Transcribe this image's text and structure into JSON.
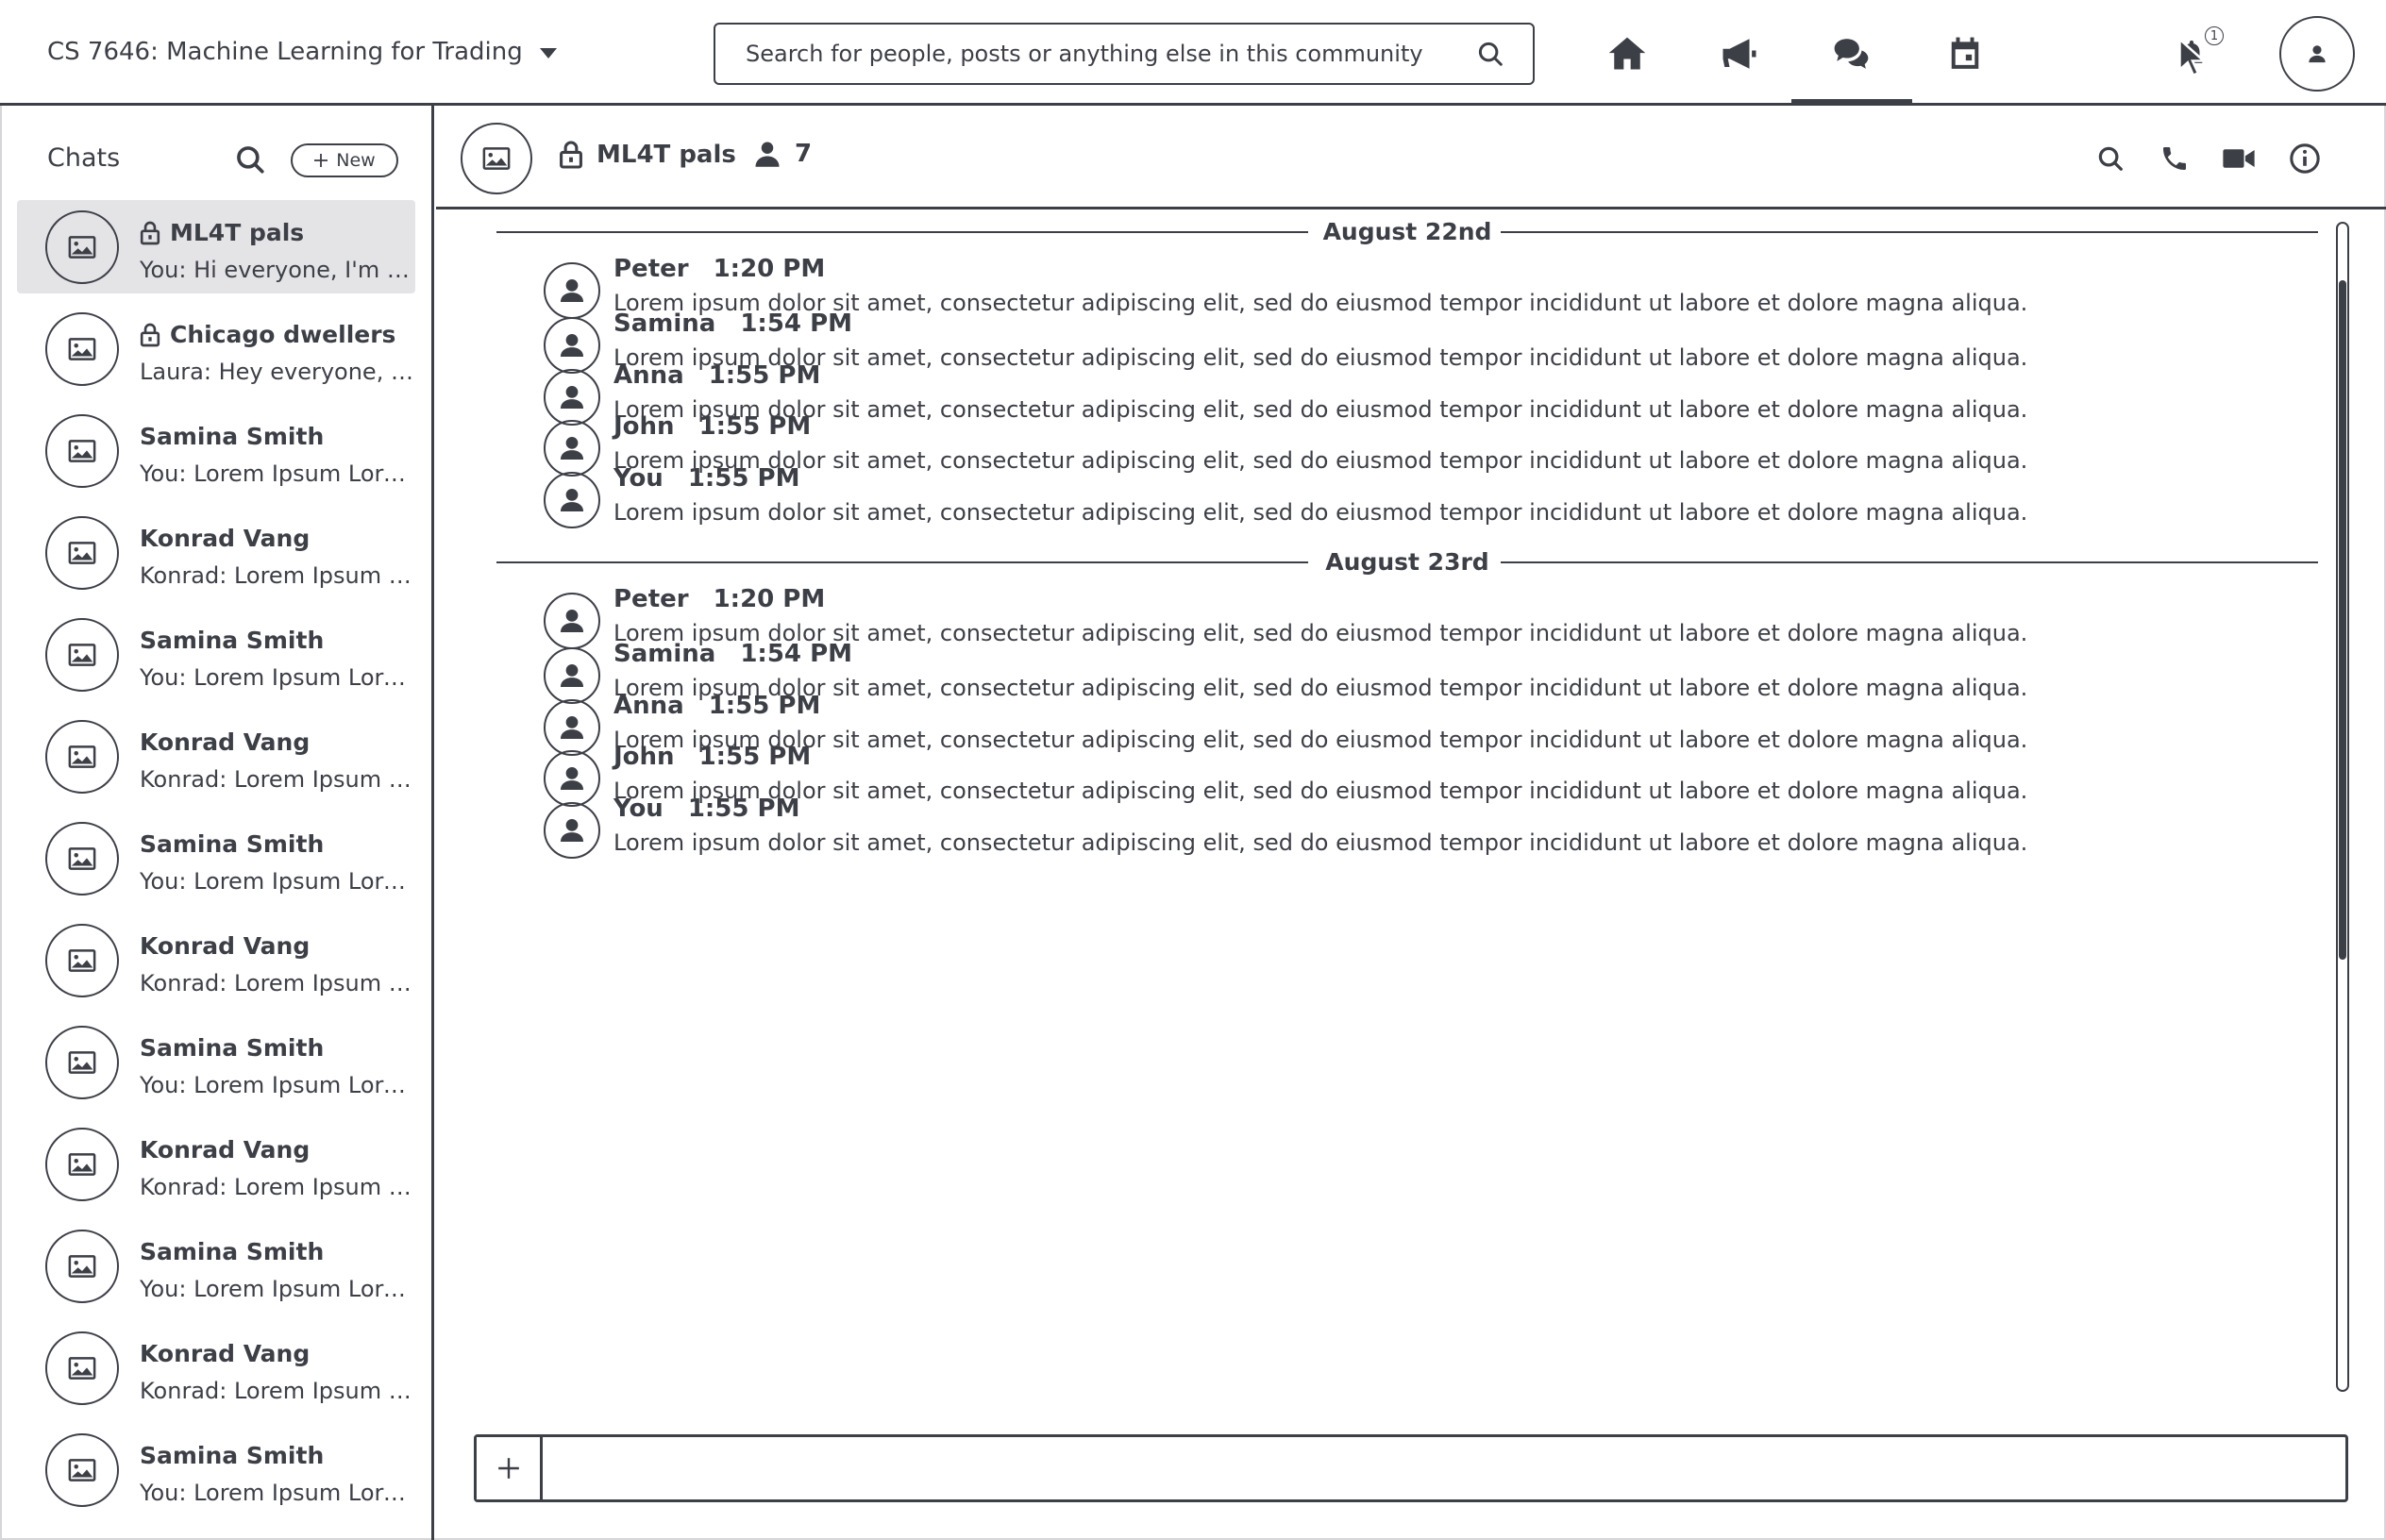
{
  "topbar": {
    "course": "CS 7646: Machine Learning for Trading",
    "search_placeholder": "Search for people, posts or anything else in this community",
    "icons": [
      "home-icon",
      "megaphone-icon",
      "chat-icon",
      "calendar-icon",
      "bell-icon",
      "profile-icon"
    ],
    "active_nav": "chat-icon",
    "notification_count": "1"
  },
  "sidebar": {
    "title": "Chats",
    "new_label": "New",
    "chats": [
      {
        "name": "ML4T pals",
        "preview": "You: Hi everyone, I'm Mike",
        "locked": true,
        "active": true
      },
      {
        "name": "Chicago dwellers",
        "preview": "Laura: Hey everyone, great",
        "locked": true,
        "active": false
      },
      {
        "name": "Samina Smith",
        "preview": "You: Lorem Ipsum Lorem",
        "locked": false,
        "active": false
      },
      {
        "name": "Konrad Vang",
        "preview": "Konrad: Lorem Ipsum Lorem",
        "locked": false,
        "active": false
      },
      {
        "name": "Samina Smith",
        "preview": "You: Lorem Ipsum Lorem",
        "locked": false,
        "active": false
      },
      {
        "name": "Konrad Vang",
        "preview": "Konrad: Lorem Ipsum Lorem",
        "locked": false,
        "active": false
      },
      {
        "name": "Samina Smith",
        "preview": "You: Lorem Ipsum Lorem",
        "locked": false,
        "active": false
      },
      {
        "name": "Konrad Vang",
        "preview": "Konrad: Lorem Ipsum Lorem",
        "locked": false,
        "active": false
      },
      {
        "name": "Samina Smith",
        "preview": "You: Lorem Ipsum Lorem",
        "locked": false,
        "active": false
      },
      {
        "name": "Konrad Vang",
        "preview": "Konrad: Lorem Ipsum Lorem",
        "locked": false,
        "active": false
      },
      {
        "name": "Samina Smith",
        "preview": "You: Lorem Ipsum Lorem",
        "locked": false,
        "active": false
      },
      {
        "name": "Konrad Vang",
        "preview": "Konrad: Lorem Ipsum Lorem",
        "locked": false,
        "active": false
      },
      {
        "name": "Samina Smith",
        "preview": "You: Lorem Ipsum Lorem",
        "locked": false,
        "active": false
      }
    ]
  },
  "conversation": {
    "title": "ML4T pals",
    "member_count": "7",
    "tools": [
      "search-icon",
      "phone-icon",
      "video-icon",
      "info-icon"
    ]
  },
  "messages": {
    "groups": [
      {
        "date": "August 22nd",
        "items": [
          {
            "author": "Peter",
            "time": "1:20 PM",
            "text": "Lorem ipsum dolor sit amet, consectetur adipiscing elit, sed do eiusmod tempor incididunt ut labore et dolore magna aliqua."
          },
          {
            "author": "Samina",
            "time": "1:54 PM",
            "text": "Lorem ipsum dolor sit amet, consectetur adipiscing elit, sed do eiusmod tempor incididunt ut labore et dolore magna aliqua."
          },
          {
            "author": "Anna",
            "time": "1:55 PM",
            "text": "Lorem ipsum dolor sit amet, consectetur adipiscing elit, sed do eiusmod tempor incididunt ut labore et dolore magna aliqua."
          },
          {
            "author": "John",
            "time": "1:55 PM",
            "text": "Lorem ipsum dolor sit amet, consectetur adipiscing elit, sed do eiusmod tempor incididunt ut labore et dolore magna aliqua."
          },
          {
            "author": "You",
            "time": "1:55 PM",
            "text": "Lorem ipsum dolor sit amet, consectetur adipiscing elit, sed do eiusmod tempor incididunt ut labore et dolore magna aliqua."
          }
        ]
      },
      {
        "date": "August 23rd",
        "items": [
          {
            "author": "Peter",
            "time": "1:20 PM",
            "text": "Lorem ipsum dolor sit amet, consectetur adipiscing elit, sed do eiusmod tempor incididunt ut labore et dolore magna aliqua."
          },
          {
            "author": "Samina",
            "time": "1:54 PM",
            "text": "Lorem ipsum dolor sit amet, consectetur adipiscing elit, sed do eiusmod tempor incididunt ut labore et dolore magna aliqua."
          },
          {
            "author": "Anna",
            "time": "1:55 PM",
            "text": "Lorem ipsum dolor sit amet, consectetur adipiscing elit, sed do eiusmod tempor incididunt ut labore et dolore magna aliqua."
          },
          {
            "author": "John",
            "time": "1:55 PM",
            "text": "Lorem ipsum dolor sit amet, consectetur adipiscing elit, sed do eiusmod tempor incididunt ut labore et dolore magna aliqua."
          },
          {
            "author": "You",
            "time": "1:55 PM",
            "text": "Lorem ipsum dolor sit amet, consectetur adipiscing elit, sed do eiusmod tempor incididunt ut labore et dolore magna aliqua."
          }
        ]
      }
    ]
  },
  "composer": {
    "value": "",
    "add_icon": "plus-icon"
  },
  "colors": {
    "ink": "#3d3f47",
    "active_bg": "#e4e4e7",
    "background": "#ffffff"
  }
}
